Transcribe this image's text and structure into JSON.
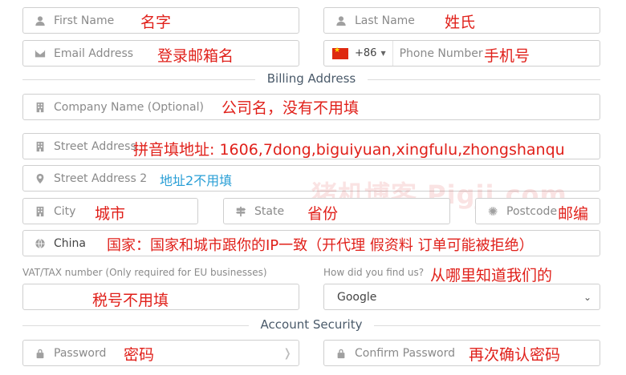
{
  "fields": {
    "first_name": "First Name",
    "last_name": "Last Name",
    "email": "Email Address",
    "phone_code": "+86",
    "phone": "Phone Number",
    "company": "Company Name (Optional)",
    "street1": "Street Address",
    "street2": "Street Address 2",
    "city": "City",
    "state": "State",
    "postcode": "Postcode",
    "country": "China",
    "vat_label": "VAT/TAX number (Only required for EU businesses)",
    "source_label": "How did you find us?",
    "source_value": "Google",
    "password": "Password",
    "confirm_password": "Confirm Password"
  },
  "sections": {
    "billing": "Billing Address",
    "security": "Account Security"
  },
  "annotations": {
    "first_name": "名字",
    "last_name": "姓氏",
    "email": "登录邮箱名",
    "phone": "手机号",
    "company": "公司名，没有不用填",
    "street1": "拼音填地址: 1606,7dong,biguiyuan,xingfulu,zhongshanqu",
    "street2": "地址2不用填",
    "city": "城市",
    "state": "省份",
    "postcode": "邮编",
    "country": "国家：国家和城市跟你的IP一致（开代理 假资料 订单可能被拒绝）",
    "vat": "税号不用填",
    "source": "从哪里知道我们的",
    "password": "密码",
    "confirm_password": "再次确认密码"
  },
  "watermark": "猪机博客 Pigji.com"
}
